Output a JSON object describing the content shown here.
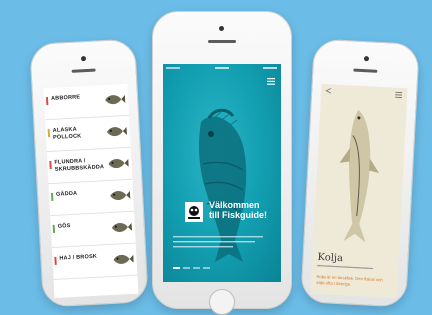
{
  "colors": {
    "background": "#6bbde8",
    "screen_teal": "#139fb2",
    "parchment": "#efe9d7",
    "link_orange": "#d8772b"
  },
  "left_phone": {
    "items": [
      {
        "name": "ABBORRE",
        "color": "#d94a45"
      },
      {
        "name": "ALASKA POLLOCK",
        "color": "#e2a33a"
      },
      {
        "name": "FLUNDRA / SKRUBBSKÄDDA",
        "color": "#d94a45"
      },
      {
        "name": "GÄDDA",
        "color": "#6aa84f"
      },
      {
        "name": "GÖS",
        "color": "#6aa84f"
      },
      {
        "name": "HAJ / BROSK",
        "color": "#d94a45"
      }
    ]
  },
  "center_phone": {
    "welcome_line1": "Välkommen",
    "welcome_line2": "till Fiskguide!",
    "logo": "wwf-panda-logo"
  },
  "right_phone": {
    "fish_name": "Kolja",
    "orange_text": "Kolja är en torskfisk. Den fiskas och säljs ofta i Sverige."
  }
}
